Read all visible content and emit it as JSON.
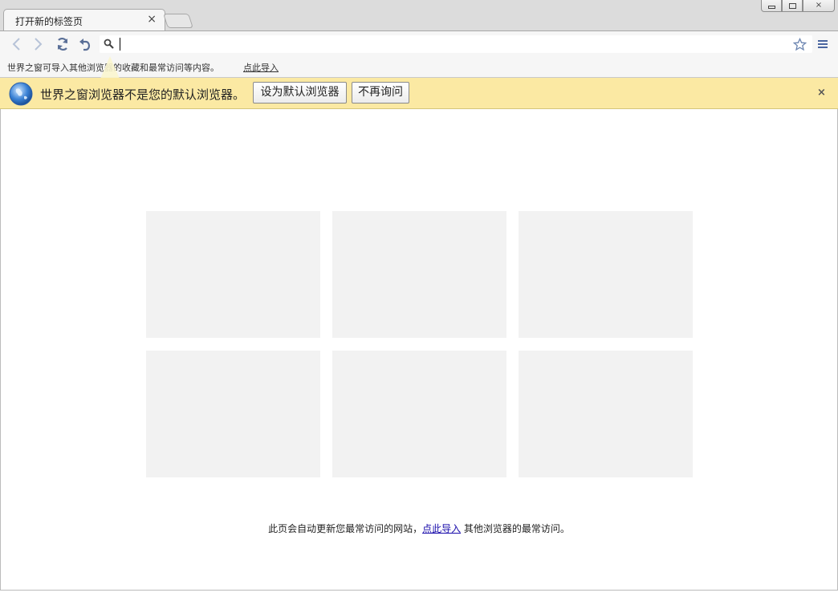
{
  "tab": {
    "title": "打开新的标签页",
    "close_glyph": "×"
  },
  "window_controls": {
    "close_glyph": "×"
  },
  "toolbar": {
    "back_icon": "chevron-left-icon",
    "forward_icon": "chevron-right-icon",
    "reload_icon": "reload-icon",
    "undo_icon": "undo-icon",
    "omnibox": {
      "value": "",
      "placeholder": ""
    }
  },
  "import_bar": {
    "text": "世界之窗可导入其他浏览器的收藏和最常访问等内容。",
    "link": "点此导入"
  },
  "infobar": {
    "message": "世界之窗浏览器不是您的默认浏览器。",
    "set_default_label": "设为默认浏览器",
    "never_ask_label": "不再询问",
    "close_glyph": "×"
  },
  "content": {
    "tiles": [
      "",
      "",
      "",
      "",
      "",
      ""
    ],
    "note_before": "此页会自动更新您最常访问的网站，",
    "note_link": "点此导入",
    "note_after": " 其他浏览器的最常访问。"
  },
  "colors": {
    "infobar_bg": "#fbe9a3",
    "tile_bg": "#f2f2f2",
    "toolbar_bg": "#f6f6f6",
    "nav_icon": "#6b84b0"
  }
}
